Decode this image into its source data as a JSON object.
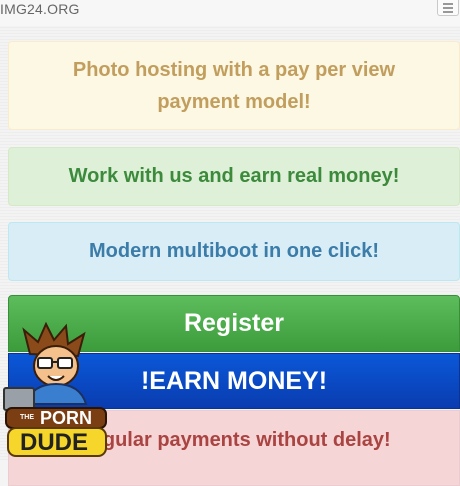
{
  "header": {
    "site_title": "IMG24.ORG"
  },
  "alerts": {
    "pay_per_view": "Photo hosting with a pay per view payment model!",
    "earn_money": "Work with us and earn real money!",
    "multiboot": "Modern multiboot in one click!",
    "regular_payments": "Regular payments without delay!"
  },
  "buttons": {
    "register": "Register",
    "earn": "!EARN MONEY!"
  },
  "ad_badge": {
    "line1": "PORN",
    "line2": "DUDE",
    "prefix": "THE"
  },
  "colors": {
    "register": "#47a947",
    "earn": "#0a48c8",
    "warning_text": "#c29e5e",
    "success_text": "#3c8a3c",
    "info_text": "#3b7ca9",
    "danger_text": "#a94442"
  },
  "icons": {
    "menu": "hamburger-menu-icon"
  }
}
